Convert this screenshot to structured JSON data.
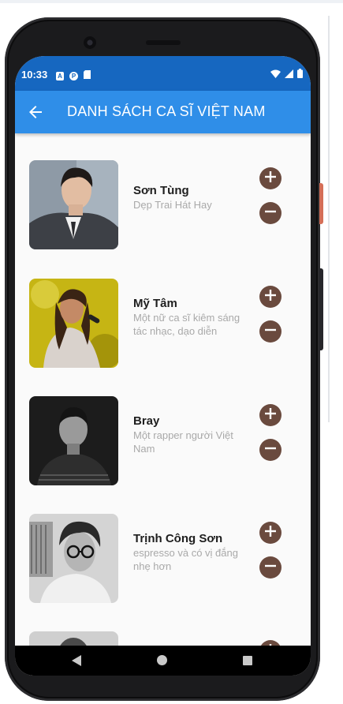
{
  "status_bar": {
    "time": "10:33",
    "left_icons": [
      "A",
      "P",
      "sd-card-icon"
    ]
  },
  "app_bar": {
    "title": "DANH SÁCH CA SĨ VIỆT NAM",
    "back_icon": "arrow-back-icon"
  },
  "singers": [
    {
      "name": "Sơn Tùng",
      "description": "Dẹp Trai Hát Hay"
    },
    {
      "name": "Mỹ Tâm",
      "description": "Một nữ ca sĩ kiêm sáng tác nhạc, dạo diễn"
    },
    {
      "name": "Bray",
      "description": "Một rapper người Việt Nam"
    },
    {
      "name": "Trịnh Công Sơn",
      "description": "espresso và có vị đắng nhẹ hơn"
    }
  ],
  "colors": {
    "status_bar": "#1667c0",
    "app_bar": "#2f8ee8",
    "action_button": "#6a4a3e",
    "description_text": "#a9a9a9"
  },
  "icons": {
    "add": "plus-circle-icon",
    "remove": "minus-circle-icon"
  }
}
